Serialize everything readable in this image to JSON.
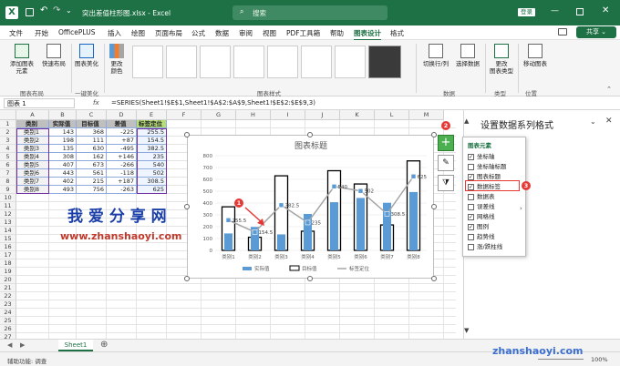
{
  "titlebar": {
    "filename": "突出差值柱形图.xlsx - Excel",
    "search_placeholder": "搜索",
    "login_label": "登录"
  },
  "menu": [
    "文件",
    "开始",
    "OfficePLUS",
    "插入",
    "绘图",
    "页面布局",
    "公式",
    "数据",
    "审阅",
    "视图",
    "PDF工具箱",
    "帮助",
    "图表设计",
    "格式"
  ],
  "share_label": "共享",
  "ribbon": {
    "add_element": "添加图表\n元素",
    "quick_layout": "快速布局",
    "chart_beautify": "图表美化",
    "change_colors": "更改\n颜色",
    "switch_row_col": "切换行/列",
    "select_data": "选择数据",
    "change_type": "更改\n图表类型",
    "move_chart": "移动图表",
    "groups": [
      "图表布局",
      "一键美化",
      "图表样式",
      "数据",
      "类型",
      "位置"
    ]
  },
  "formula_bar": {
    "name_box": "图表 1",
    "fx": "fx",
    "formula": "=SERIES(Sheet1!$E$1,Sheet1!$A$2:$A$9,Sheet1!$E$2:$E$9,3)"
  },
  "columns": [
    "A",
    "B",
    "C",
    "D",
    "E",
    "F",
    "G",
    "H",
    "I",
    "J",
    "K",
    "L",
    "M"
  ],
  "rows": [
    "1",
    "2",
    "3",
    "4",
    "5",
    "6",
    "7",
    "8",
    "9",
    "10",
    "11",
    "12",
    "13",
    "14",
    "15",
    "16",
    "17",
    "18",
    "19",
    "20",
    "21",
    "22",
    "23",
    "24",
    "25",
    "26",
    "27"
  ],
  "table": {
    "headers": [
      "类别",
      "实际值",
      "目标值",
      "差值",
      "标签定位"
    ],
    "data": [
      [
        "类别1",
        "143",
        "368",
        "-225",
        "255.5"
      ],
      [
        "类别2",
        "198",
        "111",
        "+87",
        "154.5"
      ],
      [
        "类别3",
        "135",
        "630",
        "-495",
        "382.5"
      ],
      [
        "类别4",
        "308",
        "162",
        "+146",
        "235"
      ],
      [
        "类别5",
        "407",
        "673",
        "-266",
        "540"
      ],
      [
        "类别6",
        "443",
        "561",
        "-118",
        "502"
      ],
      [
        "类别7",
        "402",
        "215",
        "+187",
        "308.5"
      ],
      [
        "类别8",
        "493",
        "756",
        "-263",
        "625"
      ]
    ]
  },
  "watermark": {
    "cn": "我 爱 分 享 网",
    "url": "www.zhanshaoyi.com",
    "bottom_url": "zhanshaoyi.com"
  },
  "chart_data": {
    "type": "bar",
    "title": "图表标题",
    "categories": [
      "类别1",
      "类别2",
      "类别3",
      "类别4",
      "类别5",
      "类别6",
      "类别7",
      "类别8"
    ],
    "series": [
      {
        "name": "实际值",
        "values": [
          143,
          198,
          135,
          308,
          407,
          443,
          402,
          493
        ],
        "color": "#5b9bd5"
      },
      {
        "name": "目标值",
        "values": [
          368,
          111,
          630,
          162,
          673,
          561,
          215,
          756
        ],
        "color": "#000000"
      },
      {
        "name": "标签定位",
        "values": [
          255.5,
          154.5,
          382.5,
          235,
          540,
          502,
          308.5,
          625
        ],
        "color": "#a5a5a5"
      }
    ],
    "data_labels": [
      "255.5",
      "154.5",
      "382.5",
      "235",
      "540",
      "502",
      "308.5",
      "625"
    ],
    "y_ticks": [
      "0",
      "100",
      "200",
      "300",
      "400",
      "500",
      "600",
      "700",
      "800"
    ],
    "ylim": [
      0,
      800
    ],
    "legend": "bottom"
  },
  "callouts": [
    "1",
    "2",
    "3"
  ],
  "panel": {
    "title": "设置数据系列格式",
    "popup_title": "图表元素",
    "items": [
      {
        "label": "坐标轴",
        "checked": true
      },
      {
        "label": "坐标轴标题",
        "checked": false
      },
      {
        "label": "图表标题",
        "checked": true
      },
      {
        "label": "数据标签",
        "checked": true
      },
      {
        "label": "数据表",
        "checked": false
      },
      {
        "label": "误差线",
        "checked": false
      },
      {
        "label": "网格线",
        "checked": true
      },
      {
        "label": "图例",
        "checked": true
      },
      {
        "label": "趋势线",
        "checked": false
      },
      {
        "label": "涨/跌柱线",
        "checked": false
      }
    ]
  },
  "sheet_tab": "Sheet1",
  "status": {
    "text": "辅助功能: 调查",
    "zoom": "100%"
  },
  "colors": {
    "accent": "#1e7145",
    "callout": "#e53935",
    "watermark_cn": "#1a3fa8",
    "watermark_url": "#c0392b"
  }
}
